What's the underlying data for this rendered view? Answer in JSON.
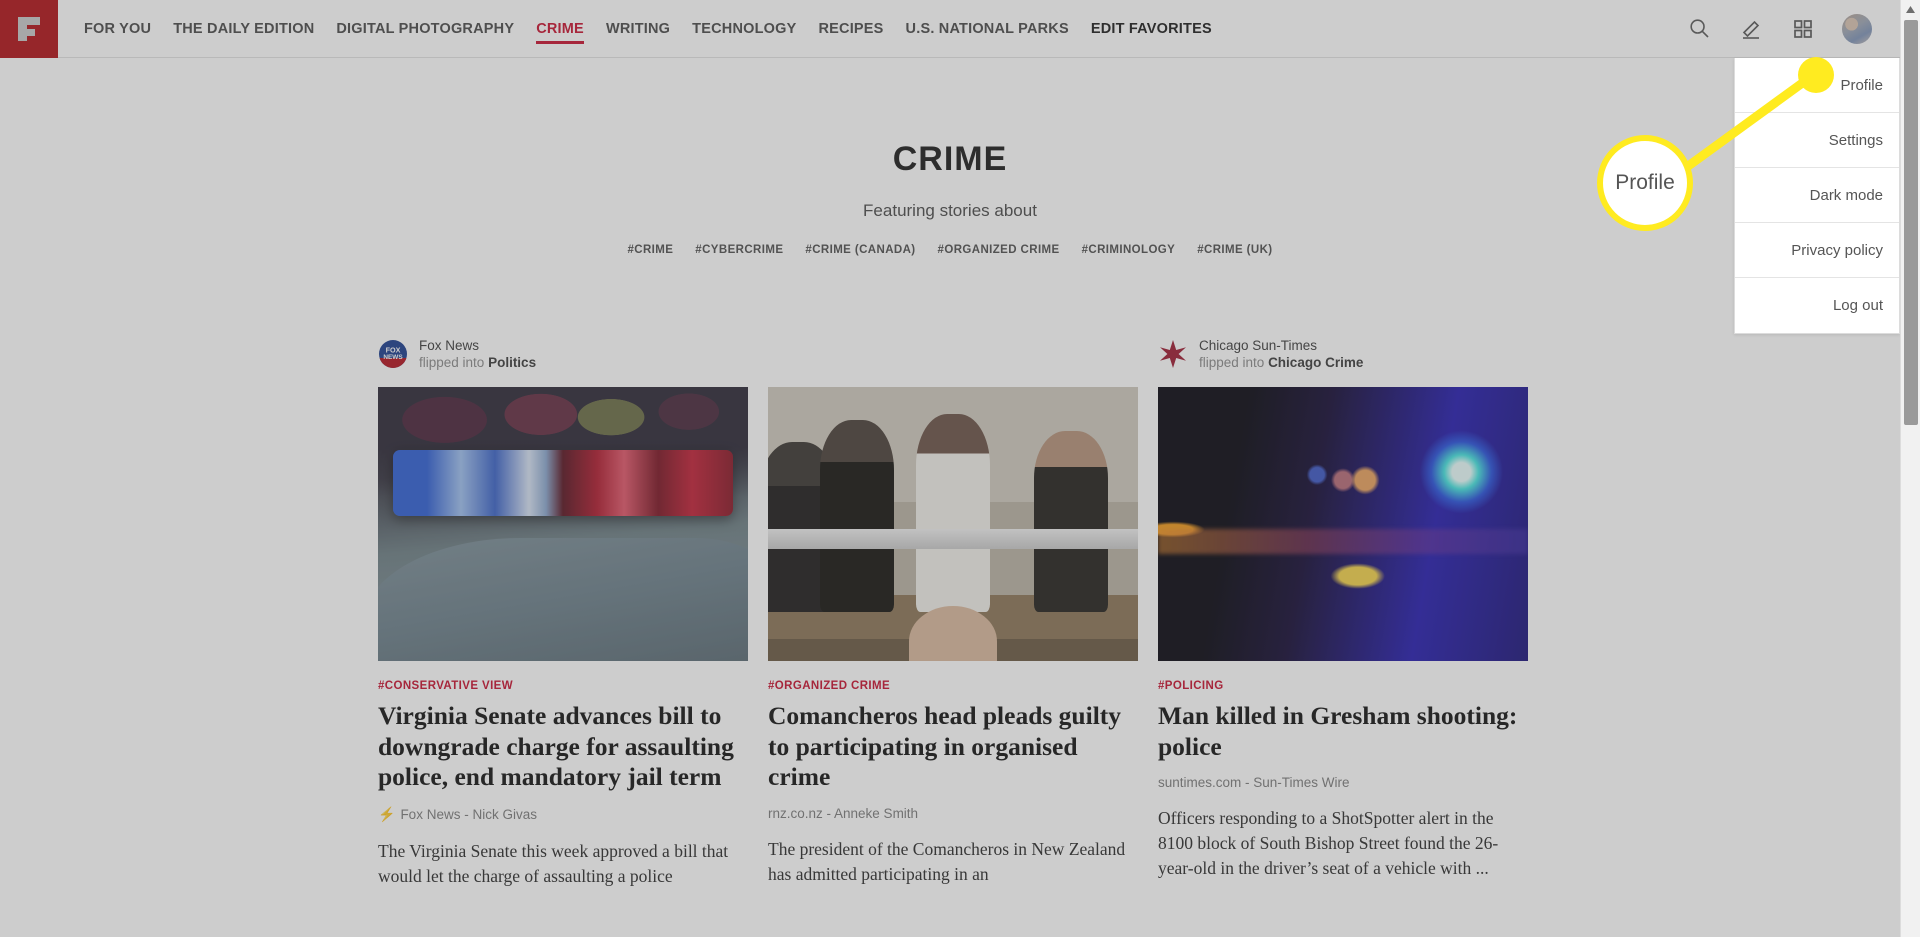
{
  "brand": {
    "logo_icon": "flipboard-logo-icon",
    "logo_color": "#b01116",
    "accent_color": "#c8102e"
  },
  "nav": {
    "items": [
      {
        "label": "FOR YOU",
        "active": false,
        "strong": false
      },
      {
        "label": "THE DAILY EDITION",
        "active": false,
        "strong": false
      },
      {
        "label": "DIGITAL PHOTOGRAPHY",
        "active": false,
        "strong": false
      },
      {
        "label": "CRIME",
        "active": true,
        "strong": false
      },
      {
        "label": "WRITING",
        "active": false,
        "strong": false
      },
      {
        "label": "TECHNOLOGY",
        "active": false,
        "strong": false
      },
      {
        "label": "RECIPES",
        "active": false,
        "strong": false
      },
      {
        "label": "U.S. NATIONAL PARKS",
        "active": false,
        "strong": false
      },
      {
        "label": "EDIT FAVORITES",
        "active": false,
        "strong": true
      }
    ]
  },
  "header_actions": {
    "search_icon": "search-icon",
    "compose_icon": "pencil-icon",
    "grid_icon": "grid-icon",
    "avatar_icon": "avatar"
  },
  "dropdown": {
    "open": true,
    "items": [
      {
        "label": "Profile"
      },
      {
        "label": "Settings"
      },
      {
        "label": "Dark mode"
      },
      {
        "label": "Privacy policy"
      },
      {
        "label": "Log out"
      }
    ]
  },
  "annotation": {
    "label": "Profile",
    "color": "#ffeb20"
  },
  "magazine": {
    "title": "CRIME",
    "subtitle": "Featuring stories about",
    "tags": [
      "#CRIME",
      "#CYBERCRIME",
      "#CRIME (CANADA)",
      "#ORGANIZED CRIME",
      "#CRIMINOLOGY",
      "#CRIME (UK)"
    ]
  },
  "cards": [
    {
      "attribution": {
        "show": true,
        "source": "Fox News",
        "flipped_prefix": "flipped into ",
        "flipped_into": "Politics",
        "logo_icon": "fox-news-logo-icon"
      },
      "image_name": "police-car-lightbar-photo",
      "tag": "#CONSERVATIVE VIEW",
      "title": "Virginia Senate advances bill to downgrade charge for assaulting police, end mandatory jail term",
      "byline": "Fox News - Nick Givas",
      "has_bolt": true,
      "excerpt": "The Virginia Senate this week approved a bill that would let the charge of assaulting a police"
    },
    {
      "attribution": {
        "show": false
      },
      "image_name": "courtroom-defendants-photo",
      "tag": "#ORGANIZED CRIME",
      "title": "Comancheros head pleads guilty to participating in organised crime",
      "byline": "rnz.co.nz - Anneke Smith",
      "has_bolt": false,
      "excerpt": "The president of the Comancheros in New Zealand has admitted participating in an"
    },
    {
      "attribution": {
        "show": true,
        "source": "Chicago Sun-Times",
        "flipped_prefix": "flipped into ",
        "flipped_into": "Chicago Crime",
        "logo_icon": "chicago-sun-times-star-icon"
      },
      "image_name": "night-police-lights-photo",
      "tag": "#POLICING",
      "title": "Man killed in Gresham shooting: police",
      "byline": "suntimes.com - Sun-Times Wire",
      "has_bolt": false,
      "excerpt": "Officers responding to a ShotSpotter alert in the 8100 block of South Bishop Street found the 26-year-old in the driver’s seat of a vehicle with ..."
    }
  ]
}
